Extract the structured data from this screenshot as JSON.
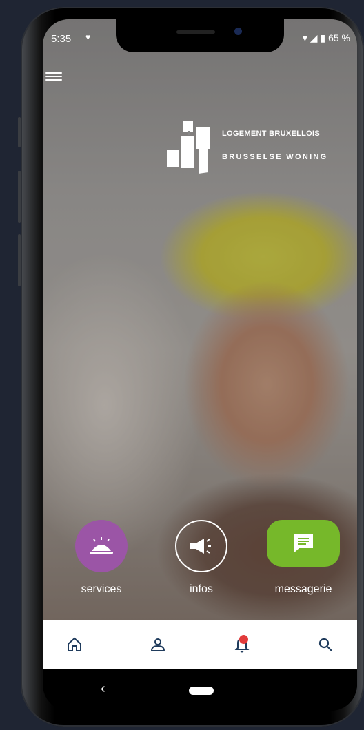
{
  "status_bar": {
    "time": "5:35",
    "battery": "65 %"
  },
  "logo": {
    "line1": "LOGEMENT BRUXELLOIS",
    "line2": "BRUSSELSE WONING"
  },
  "actions": [
    {
      "label": "services",
      "icon": "service-bell-icon",
      "color": "#9b55a6"
    },
    {
      "label": "infos",
      "icon": "megaphone-icon",
      "color": "#ffffff"
    },
    {
      "label": "messagerie",
      "icon": "message-icon",
      "color": "#76b82a"
    }
  ],
  "bottom_nav": [
    {
      "icon": "home-icon"
    },
    {
      "icon": "profile-icon"
    },
    {
      "icon": "bell-icon",
      "notification": true
    },
    {
      "icon": "search-icon"
    }
  ],
  "colors": {
    "nav_icon": "#1f3b5c",
    "notification": "#e23b3b"
  }
}
